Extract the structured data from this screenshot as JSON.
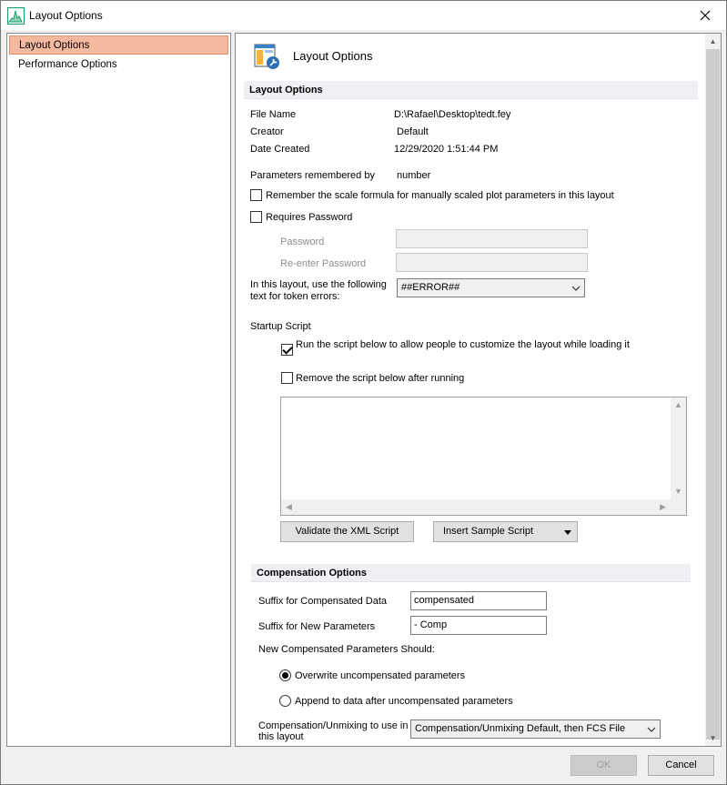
{
  "window": {
    "title": "Layout Options"
  },
  "sidebar": {
    "items": [
      {
        "label": "Layout Options",
        "selected": true
      },
      {
        "label": "Performance Options",
        "selected": false
      }
    ]
  },
  "header": {
    "title": "Layout Options"
  },
  "layout_section": {
    "title": "Layout Options",
    "file_name_label": "File Name",
    "file_name_value": "D:\\Rafael\\Desktop\\tedt.fey",
    "creator_label": "Creator",
    "creator_value": "Default",
    "date_created_label": "Date Created",
    "date_created_value": "12/29/2020 1:51:44 PM",
    "params_label": "Parameters remembered by",
    "params_value": "number",
    "remember_scale_label": "Remember the scale formula for manually scaled plot parameters in this layout",
    "requires_password_label": "Requires Password",
    "password_label": "Password",
    "reenter_password_label": "Re-enter Password",
    "token_errors_label": "In this layout, use the following text for token errors:",
    "token_errors_value": "##ERROR##",
    "startup_script_label": "Startup Script",
    "run_script_label": "Run the script below to allow people to customize the layout while loading it",
    "remove_script_label": "Remove the script below after running",
    "validate_button": "Validate the XML Script",
    "insert_sample_button": "Insert Sample Script"
  },
  "compensation_section": {
    "title": "Compensation Options",
    "suffix_comp_label": "Suffix for Compensated Data",
    "suffix_comp_value": "compensated",
    "suffix_new_label": "Suffix for New Parameters",
    "suffix_new_value": "- Comp",
    "new_params_label": "New Compensated Parameters Should:",
    "overwrite_label": "Overwrite uncompensated parameters",
    "append_label": "Append to data after uncompensated parameters",
    "unmixing_label": "Compensation/Unmixing to use in this layout",
    "unmixing_value": "Compensation/Unmixing Default, then FCS File"
  },
  "footer": {
    "ok_label": "OK",
    "cancel_label": "Cancel"
  }
}
